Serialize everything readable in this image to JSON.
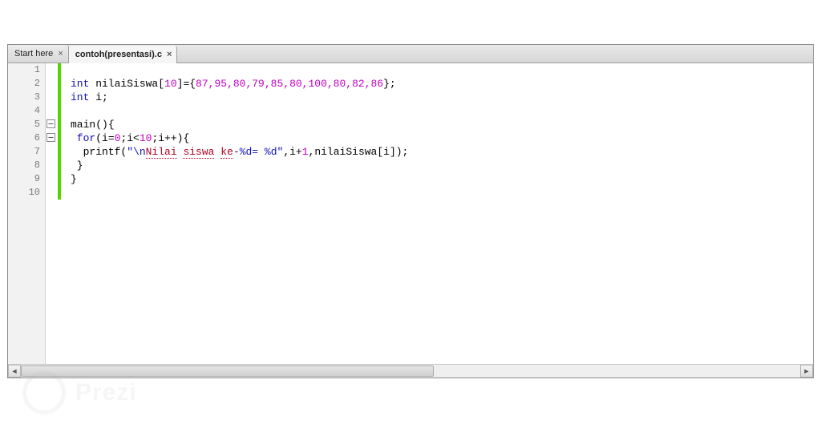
{
  "tabs": [
    {
      "label": "Start here",
      "active": false
    },
    {
      "label": "contoh(presentasi).c",
      "active": true
    }
  ],
  "line_numbers": [
    "1",
    "2",
    "3",
    "4",
    "5",
    "6",
    "7",
    "8",
    "9",
    "10"
  ],
  "code": {
    "l1": "",
    "l2_a": "int",
    "l2_b": " nilaiSiswa[",
    "l2_c": "10",
    "l2_d": "]={",
    "l2_e": "87,95,80,79,85,80,100,80,82,86",
    "l2_f": "};",
    "l3_a": "int",
    "l3_b": " i;",
    "l4": "",
    "l5_a": "main",
    "l5_b": "(){",
    "l6_a": " for",
    "l6_b": "(i=",
    "l6_c": "0",
    "l6_d": ";i<",
    "l6_e": "10",
    "l6_f": ";i++){",
    "l7_a": "  printf(",
    "l7_b": "\"\\n",
    "l7_c": "Nilai",
    "l7_d": " ",
    "l7_e": "siswa",
    "l7_f": " ",
    "l7_g": "ke",
    "l7_h": "-%d= %d\"",
    "l7_i": ",i+",
    "l7_j": "1",
    "l7_k": ",nilaiSiswa[i]);",
    "l8": " }",
    "l9": "}",
    "l10": ""
  },
  "scrollbar": {
    "left_glyph": "◄",
    "right_glyph": "►"
  },
  "logo_text": "Prezi"
}
